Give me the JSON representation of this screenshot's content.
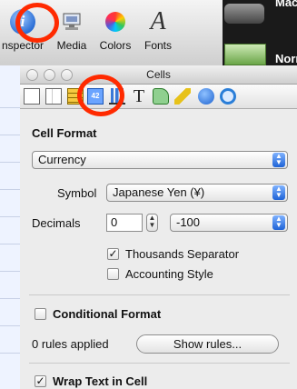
{
  "toolbar": {
    "items": [
      {
        "label": "nspector",
        "icon": "inspector-icon"
      },
      {
        "label": "Media",
        "icon": "media-icon"
      },
      {
        "label": "Colors",
        "icon": "colors-icon"
      },
      {
        "label": "Fonts",
        "icon": "fonts-icon"
      }
    ],
    "right_text_top": "Mac",
    "right_text_bottom": "Norr"
  },
  "window": {
    "title": "Cells"
  },
  "inspector_tabs": [
    "document-icon",
    "layout-icon",
    "table-icon",
    "cells-icon",
    "chart-icon",
    "text-icon",
    "graphic-icon",
    "metrics-icon",
    "hyperlink-icon",
    "quicktime-icon"
  ],
  "cells_tab_label": "42",
  "cell_format": {
    "title": "Cell Format",
    "format_value": "Currency",
    "symbol_label": "Symbol",
    "symbol_value": "Japanese Yen (¥)",
    "decimals_label": "Decimals",
    "decimals_value": "0",
    "negative_value": "-100",
    "thousands_label": "Thousands Separator",
    "thousands_checked": true,
    "accounting_label": "Accounting Style",
    "accounting_checked": false
  },
  "conditional_format": {
    "title": "Conditional Format",
    "checked": false,
    "rules_status": "0 rules applied",
    "show_rules_label": "Show rules..."
  },
  "wrap_text": {
    "label": "Wrap Text in Cell",
    "checked": true
  },
  "colors": {
    "highlight_ring": "#ff2a00",
    "accent_blue": "#1e63d6"
  }
}
